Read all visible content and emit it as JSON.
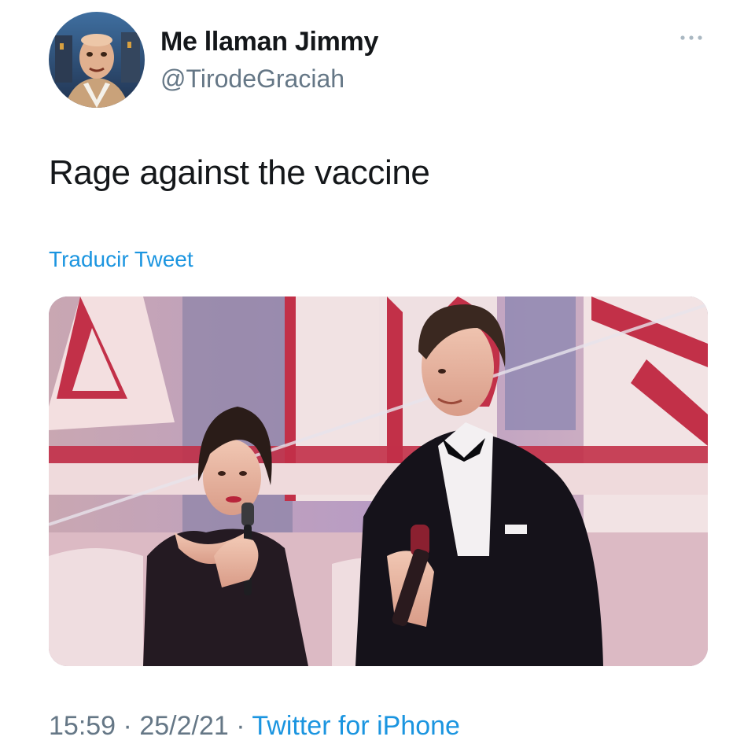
{
  "author": {
    "display_name": "Me llaman Jimmy",
    "handle": "@TirodeGraciah",
    "avatar_icon": "profile-avatar"
  },
  "menu": {
    "icon": "more-options-icon"
  },
  "tweet": {
    "text": "Rage against the vaccine",
    "translate_label": "Traducir Tweet"
  },
  "media": {
    "type": "photo"
  },
  "meta": {
    "time": "15:59",
    "separator": "·",
    "date": "25/2/21",
    "source": "Twitter for iPhone"
  },
  "colors": {
    "link": "#1b95e0",
    "secondary_text": "#657786",
    "primary_text": "#14171a"
  }
}
